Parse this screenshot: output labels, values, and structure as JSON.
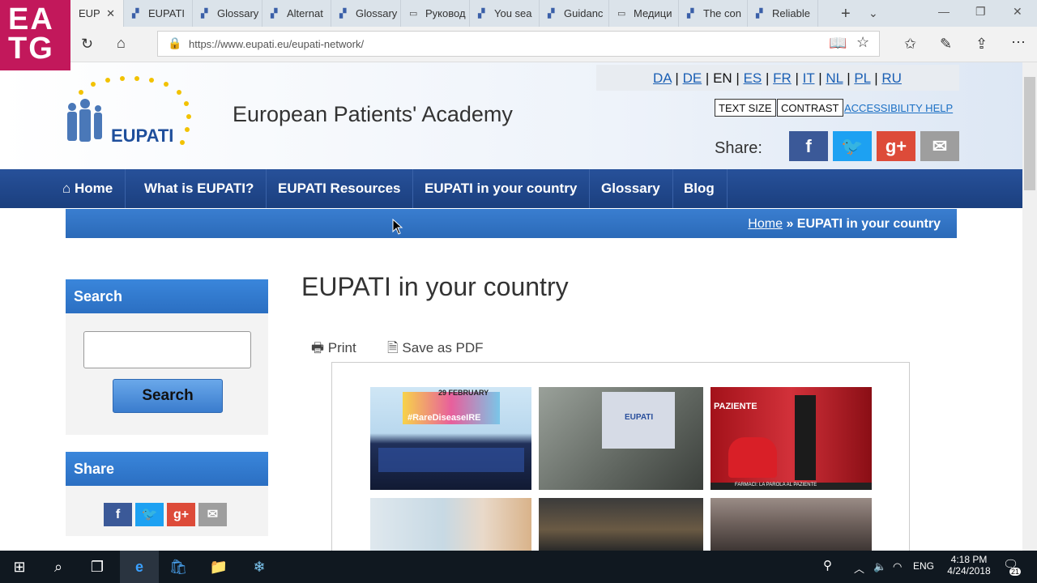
{
  "browser": {
    "tabs": [
      {
        "label": "EUP",
        "active": true
      },
      {
        "label": "EUPATI"
      },
      {
        "label": "Glossary"
      },
      {
        "label": "Alternat"
      },
      {
        "label": "Glossary"
      },
      {
        "label": "Руковод"
      },
      {
        "label": "You sea"
      },
      {
        "label": "Guidanc"
      },
      {
        "label": "Медици"
      },
      {
        "label": "The con"
      },
      {
        "label": "Reliable"
      }
    ],
    "url": "https://www.eupati.eu/eupati-network/"
  },
  "overlay_logo": {
    "line1": "EA",
    "line2": "TG"
  },
  "site": {
    "title": "European Patients' Academy",
    "logo_text": "EUPATI",
    "languages": [
      "DA",
      "DE",
      "EN",
      "ES",
      "FR",
      "IT",
      "NL",
      "PL",
      "RU"
    ],
    "current_language": "EN",
    "text_size": "TEXT SIZE",
    "contrast": "CONTRAST",
    "accessibility_help": "ACCESSIBILITY HELP",
    "share_label": "Share:"
  },
  "nav": {
    "items": [
      "Home",
      "What is EUPATI?",
      "EUPATI Resources",
      "EUPATI in your country",
      "Glossary",
      "Blog"
    ]
  },
  "breadcrumb": {
    "home": "Home",
    "separator": "»",
    "current": "EUPATI in your country"
  },
  "sidebar": {
    "search_heading": "Search",
    "search_button": "Search",
    "search_value": "",
    "share_heading": "Share"
  },
  "main": {
    "title": "EUPATI in your country",
    "print": "Print",
    "save_pdf": "Save as PDF",
    "photo1_banner": "29 FEBRUARY",
    "photo1_tag": "#RareDiseaseIRE",
    "photo2_text": "EUPATI",
    "photo3_top": "PAZIENTE",
    "photo3_bottom": "FARMACI: LA PAROLA AL PAZIENTE"
  },
  "taskbar": {
    "time": "4:18 PM",
    "date": "4/24/2018",
    "lang": "ENG",
    "notifications": "21"
  },
  "colors": {
    "nav": "#1b3f7e",
    "accent": "#2b6fc2",
    "facebook": "#3b5998",
    "twitter": "#1da1f2",
    "gplus": "#dd4b39",
    "email": "#9e9e9e"
  }
}
